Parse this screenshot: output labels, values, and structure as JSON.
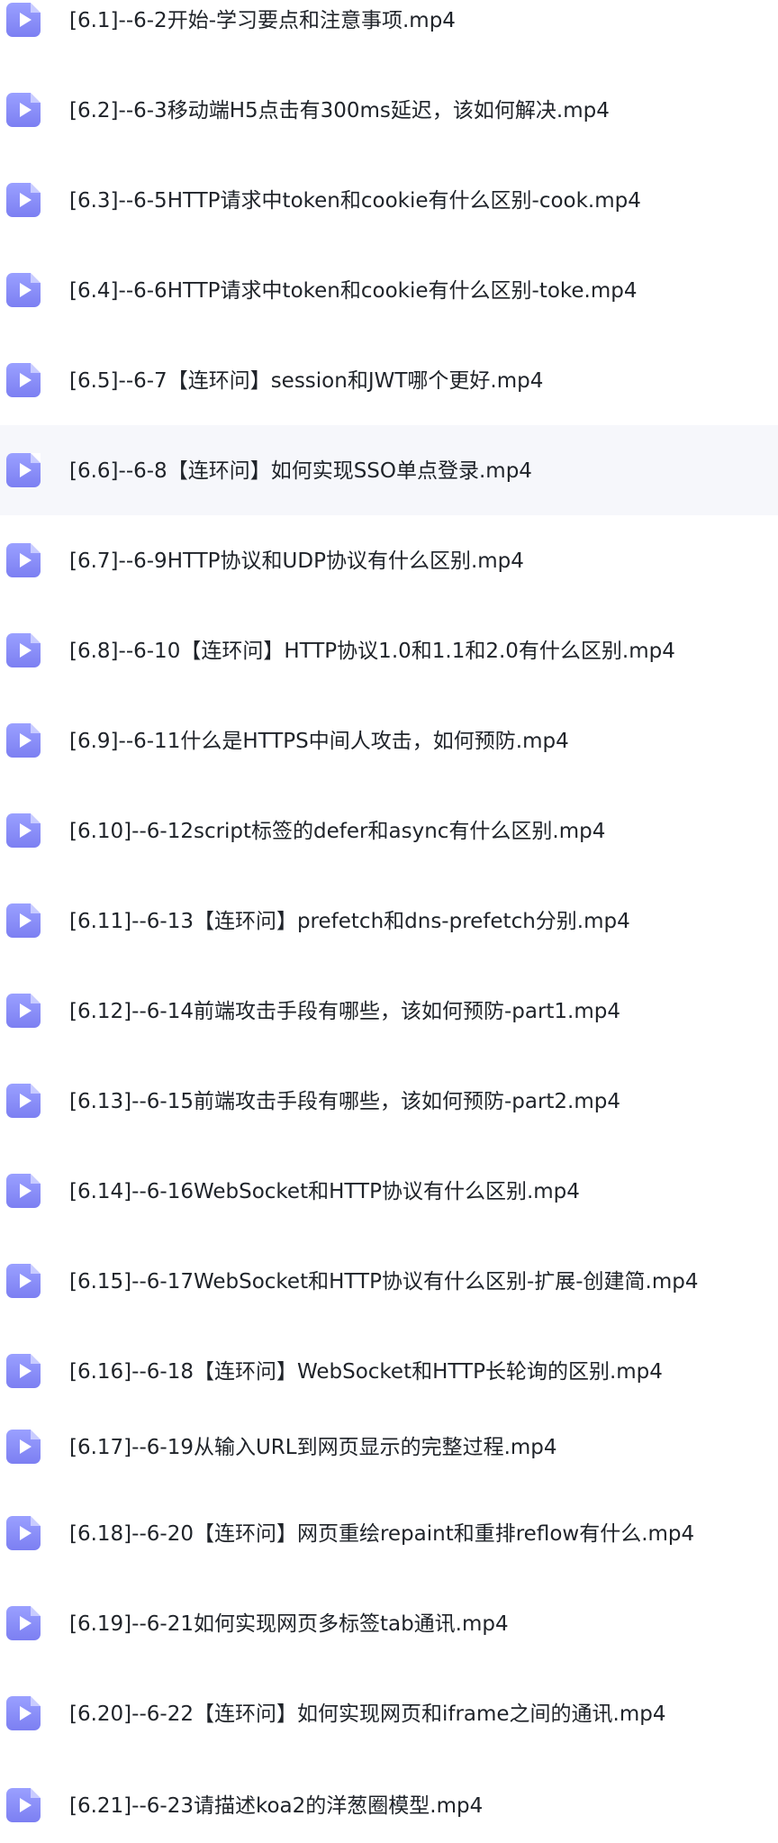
{
  "files": [
    {
      "name": "[6.1]--6-2开始-学习要点和注意事项.mp4",
      "icon": "video-file-icon"
    },
    {
      "name": "[6.2]--6-3移动端H5点击有300ms延迟，该如何解决.mp4",
      "icon": "video-file-icon"
    },
    {
      "name": "[6.3]--6-5HTTP请求中token和cookie有什么区别-cook.mp4",
      "icon": "video-file-icon"
    },
    {
      "name": "[6.4]--6-6HTTP请求中token和cookie有什么区别-toke.mp4",
      "icon": "video-file-icon"
    },
    {
      "name": "[6.5]--6-7【连环问】session和JWT哪个更好.mp4",
      "icon": "video-file-icon"
    },
    {
      "name": "[6.6]--6-8【连环问】如何实现SSO单点登录.mp4",
      "icon": "video-file-icon"
    },
    {
      "name": "[6.7]--6-9HTTP协议和UDP协议有什么区别.mp4",
      "icon": "video-file-icon"
    },
    {
      "name": "[6.8]--6-10【连环问】HTTP协议1.0和1.1和2.0有什么区别.mp4",
      "icon": "video-file-icon"
    },
    {
      "name": "[6.9]--6-11什么是HTTPS中间人攻击，如何预防.mp4",
      "icon": "video-file-icon"
    },
    {
      "name": "[6.10]--6-12script标签的defer和async有什么区别.mp4",
      "icon": "video-file-icon"
    },
    {
      "name": "[6.11]--6-13【连环问】prefetch和dns-prefetch分别.mp4",
      "icon": "video-file-icon"
    },
    {
      "name": "[6.12]--6-14前端攻击手段有哪些，该如何预防-part1.mp4",
      "icon": "video-file-icon"
    },
    {
      "name": "[6.13]--6-15前端攻击手段有哪些，该如何预防-part2.mp4",
      "icon": "video-file-icon"
    },
    {
      "name": "[6.14]--6-16WebSocket和HTTP协议有什么区别.mp4",
      "icon": "video-file-icon"
    },
    {
      "name": "[6.15]--6-17WebSocket和HTTP协议有什么区别-扩展-创建简.mp4",
      "icon": "video-file-icon"
    },
    {
      "name": "[6.16]--6-18【连环问】WebSocket和HTTP长轮询的区别.mp4",
      "icon": "video-file-icon"
    },
    {
      "name": "[6.17]--6-19从输入URL到网页显示的完整过程.mp4",
      "icon": "video-file-icon"
    },
    {
      "name": "[6.18]--6-20【连环问】网页重绘repaint和重排reflow有什么.mp4",
      "icon": "video-file-icon"
    },
    {
      "name": "[6.19]--6-21如何实现网页多标签tab通讯.mp4",
      "icon": "video-file-icon"
    },
    {
      "name": "[6.20]--6-22【连环问】如何实现网页和iframe之间的通讯.mp4",
      "icon": "video-file-icon"
    },
    {
      "name": "[6.21]--6-23请描述koa2的洋葱圈模型.mp4",
      "icon": "video-file-icon"
    }
  ],
  "selected_index": 5,
  "colors": {
    "icon": "#8b8ff9",
    "highlight_background": "#f6f7fb",
    "text": "#1f2329"
  }
}
